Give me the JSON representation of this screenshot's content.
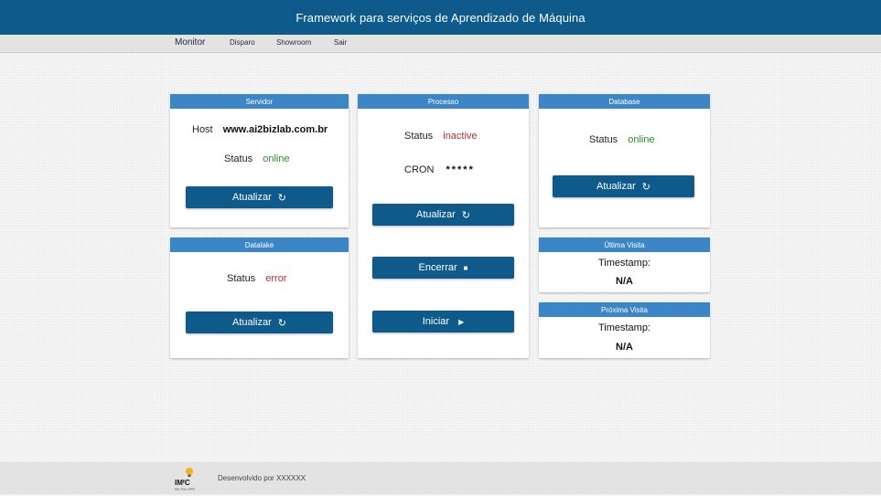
{
  "header": {
    "title": "Framework para serviços de Aprendizado de Máquina"
  },
  "nav": {
    "items": [
      "Monitor",
      "Disparo",
      "Showroom",
      "Sair"
    ]
  },
  "servidor": {
    "title": "Servidor",
    "host_label": "Host",
    "host_value": "www.ai2bizlab.com.br",
    "status_label": "Status",
    "status_value": "online",
    "button": "Atualizar"
  },
  "datalake": {
    "title": "Datalake",
    "status_label": "Status",
    "status_value": "error",
    "button": "Atualizar"
  },
  "processo": {
    "title": "Processo",
    "status_label": "Status",
    "status_value": "inactive",
    "cron_label": "CRON",
    "cron_value": "*****",
    "btn_update": "Atualizar",
    "btn_stop": "Encerrar",
    "btn_start": "Iniciar"
  },
  "database": {
    "title": "Database",
    "status_label": "Status",
    "status_value": "online",
    "button": "Atualizar"
  },
  "ultima": {
    "title": "Última Visita",
    "ts_label": "Timestamp:",
    "ts_value": "N/A"
  },
  "proxima": {
    "title": "Próxima Visita",
    "ts_label": "Timestamp:",
    "ts_value": "N/A"
  },
  "footer": {
    "text": "Desenvolvido por XXXXXX",
    "logo_text": "IMᶠC",
    "logo_sub": "DEL.POLI.UFRJ"
  },
  "colors": {
    "primary": "#0e5a8a",
    "header_card": "#3b86c6",
    "online": "#2e8b2e",
    "error": "#b0303a"
  }
}
